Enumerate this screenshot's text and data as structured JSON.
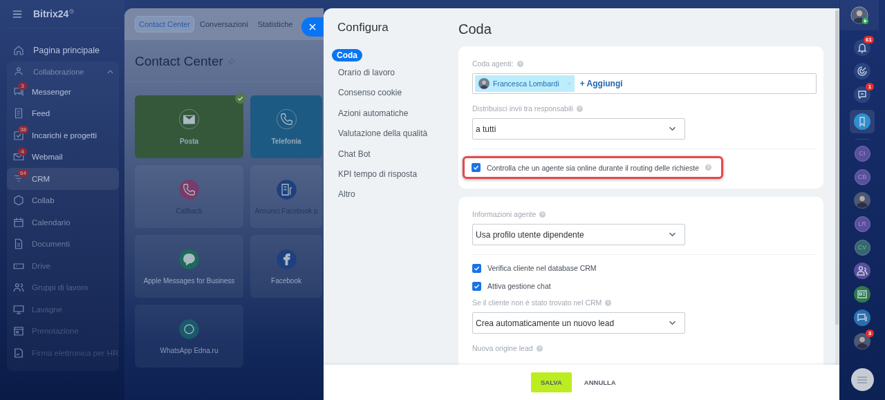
{
  "sidebar": {
    "logo": "Bitrix24",
    "home": {
      "label": "Pagina principale",
      "selected": false
    },
    "group": {
      "label": "Collaborazione",
      "expanded": true,
      "children": [
        {
          "label": "Messenger",
          "badge": "3",
          "selected": false
        },
        {
          "label": "Feed",
          "selected": false
        },
        {
          "label": "Incarichi e progetti",
          "badge": "38",
          "selected": false
        },
        {
          "label": "Webmail",
          "badge": "4",
          "selected": false
        },
        {
          "label": "CRM",
          "badge": "64",
          "selected": true
        },
        {
          "label": "Collab",
          "selected": false
        },
        {
          "label": "Calendario",
          "selected": false
        },
        {
          "label": "Documenti",
          "selected": false
        },
        {
          "label": "Drive",
          "selected": false
        },
        {
          "label": "Gruppi di lavoro",
          "selected": false
        },
        {
          "label": "Lavagne",
          "selected": false
        },
        {
          "label": "Prenotazione",
          "selected": false
        },
        {
          "label": "Firma elettronica per HR",
          "selected": false
        }
      ]
    }
  },
  "contact_center": {
    "tabs": [
      {
        "label": "Contact Center",
        "selected": true
      },
      {
        "label": "Conversazioni",
        "selected": false
      },
      {
        "label": "Statistiche",
        "selected": false
      }
    ],
    "title": "Contact Center",
    "tiles": [
      {
        "label": "Posta",
        "color": "#35583b",
        "filled": true,
        "checked": true
      },
      {
        "label": "Telefonia",
        "color": "#1c5a84",
        "filled": true,
        "checked": false
      },
      {
        "label": "Callback",
        "color": "#7a3a6a",
        "filled": false,
        "checked": false
      },
      {
        "label": "Annunci Facebook p",
        "color": "#1e4080",
        "filled": false,
        "checked": false
      },
      {
        "label": "Apple Messages for Business",
        "color": "#1e6a5a",
        "filled": false,
        "checked": false
      },
      {
        "label": "Facebook",
        "color": "#1e4080",
        "filled": false,
        "checked": false
      },
      {
        "label": "WhatsApp Edna.ru",
        "color": "#1b5a6a",
        "filled": false,
        "checked": false
      }
    ]
  },
  "config": {
    "title": "Configura",
    "nav": [
      {
        "label": "Coda",
        "selected": true
      },
      {
        "label": "Orario di lavoro",
        "selected": false
      },
      {
        "label": "Consenso cookie",
        "selected": false
      },
      {
        "label": "Azioni automatiche",
        "selected": false
      },
      {
        "label": "Valutazione della qualità",
        "selected": false
      },
      {
        "label": "Chat Bot",
        "selected": false
      },
      {
        "label": "KPI tempo di risposta",
        "selected": false
      },
      {
        "label": "Altro",
        "selected": false
      }
    ],
    "heading": "Coda",
    "cards": [
      {
        "rows": [
          {
            "kind": "people",
            "label": "Coda agenti:",
            "help": true,
            "people": [
              {
                "name": "Francesca Lombardi"
              }
            ],
            "add": "+ Aggiungi"
          },
          {
            "kind": "select",
            "label": "Distribuisci invii tra responsabili",
            "help": true,
            "value": "a tutti"
          },
          {
            "kind": "divider"
          },
          {
            "kind": "checkbox",
            "label": "Controlla che un agente sia online durante il routing delle richieste",
            "help": true,
            "checked": true,
            "highlighted": true
          }
        ]
      },
      {
        "rows": [
          {
            "kind": "select",
            "label": "Informazioni agente",
            "help": true,
            "value": "Usa profilo utente dipendente"
          },
          {
            "kind": "divider"
          },
          {
            "kind": "checkbox",
            "label": "Verifica cliente nel database CRM",
            "help": false,
            "checked": true,
            "highlighted": false
          },
          {
            "kind": "checkbox",
            "label": "Attiva gestione chat",
            "help": false,
            "checked": true,
            "highlighted": false
          },
          {
            "kind": "select",
            "label": "Se il cliente non è stato trovato nel CRM",
            "help": true,
            "value": "Crea automaticamente un nuovo lead"
          },
          {
            "kind": "label",
            "label": "Nuova origine lead",
            "help": true
          }
        ]
      }
    ],
    "buttons": [
      {
        "label": "SALVA",
        "kind": "primary"
      },
      {
        "label": "ANNULLA",
        "kind": "link"
      }
    ]
  },
  "right_bar": [
    {
      "kind": "icon",
      "badge": "61",
      "selected": false
    },
    {
      "kind": "icon",
      "selected": false
    },
    {
      "kind": "icon",
      "badge": "1",
      "selected": false
    },
    {
      "kind": "icon",
      "selected": true
    },
    {
      "kind": "initials",
      "text": "CI",
      "color": "#5a4f9c",
      "selected": false
    },
    {
      "kind": "initials",
      "text": "CB",
      "color": "#5a4f9c",
      "selected": false
    },
    {
      "kind": "avatar",
      "selected": false
    },
    {
      "kind": "initials",
      "text": "LR",
      "color": "#5a4f9c",
      "selected": false
    },
    {
      "kind": "initials",
      "text": "CV",
      "color": "#2f6b68",
      "selected": false
    },
    {
      "kind": "icon",
      "selected": false
    },
    {
      "kind": "icon",
      "selected": false
    },
    {
      "kind": "icon",
      "selected": false
    },
    {
      "kind": "avatar",
      "badge": "3",
      "selected": false
    }
  ]
}
